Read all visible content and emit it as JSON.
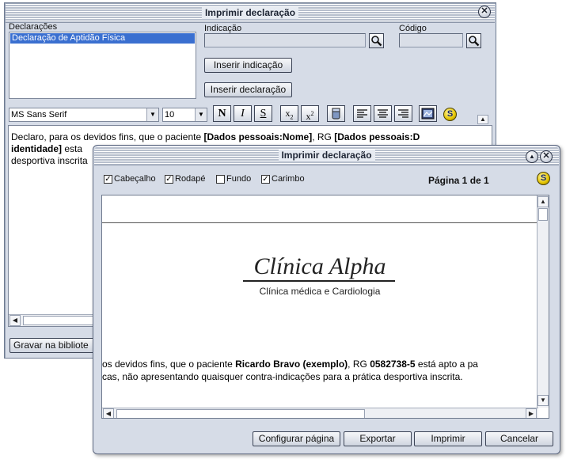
{
  "main_window": {
    "title": "Imprimir declaração",
    "declaracoes_label": "Declarações",
    "declaracoes_items": [
      "Declaração de Aptidão Física"
    ],
    "indicacao_label": "Indicação",
    "indicacao_value": "",
    "codigo_label": "Código",
    "codigo_value": "",
    "inserir_indicacao_label": "Inserir indicação",
    "inserir_declaracao_label": "Inserir declaração",
    "font_name": "MS Sans Serif",
    "font_size": "10",
    "bold_label": "N",
    "italic_label": "I",
    "strike_label": "S",
    "editor": {
      "line1_a": "Declaro, para os devidos fins, que o paciente ",
      "line1_b": "[Dados pessoais:Nome]",
      "line1_c": ", RG ",
      "line1_d": "[Dados pessoais:D",
      "line2_a": "identidade]",
      "line2_b": " esta",
      "line3": "desportiva inscrita"
    },
    "gravar_label": "Gravar na bibliote"
  },
  "dialog": {
    "title": "Imprimir declaração",
    "options": [
      {
        "label": "Cabeçalho",
        "checked": true
      },
      {
        "label": "Rodapé",
        "checked": true
      },
      {
        "label": "Fundo",
        "checked": false
      },
      {
        "label": "Carimbo",
        "checked": true
      }
    ],
    "page_indicator": "Página 1 de 1",
    "preview": {
      "clinic_name": "Clínica Alpha",
      "clinic_subtitle": "Clínica médica e Cardiologia",
      "body_line1_a": "os devidos fins, que o paciente ",
      "body_line1_b": "Ricardo Bravo (exemplo)",
      "body_line1_c": ", RG ",
      "body_line1_d": "0582738-5",
      "body_line1_e": " está apto a pa",
      "body_line2": "cas, não apresentando quaisquer contra-indicações para a prática desportiva inscrita."
    },
    "buttons": {
      "configurar": "Configurar página",
      "exportar": "Exportar",
      "imprimir": "Imprimir",
      "cancelar": "Cancelar"
    }
  }
}
